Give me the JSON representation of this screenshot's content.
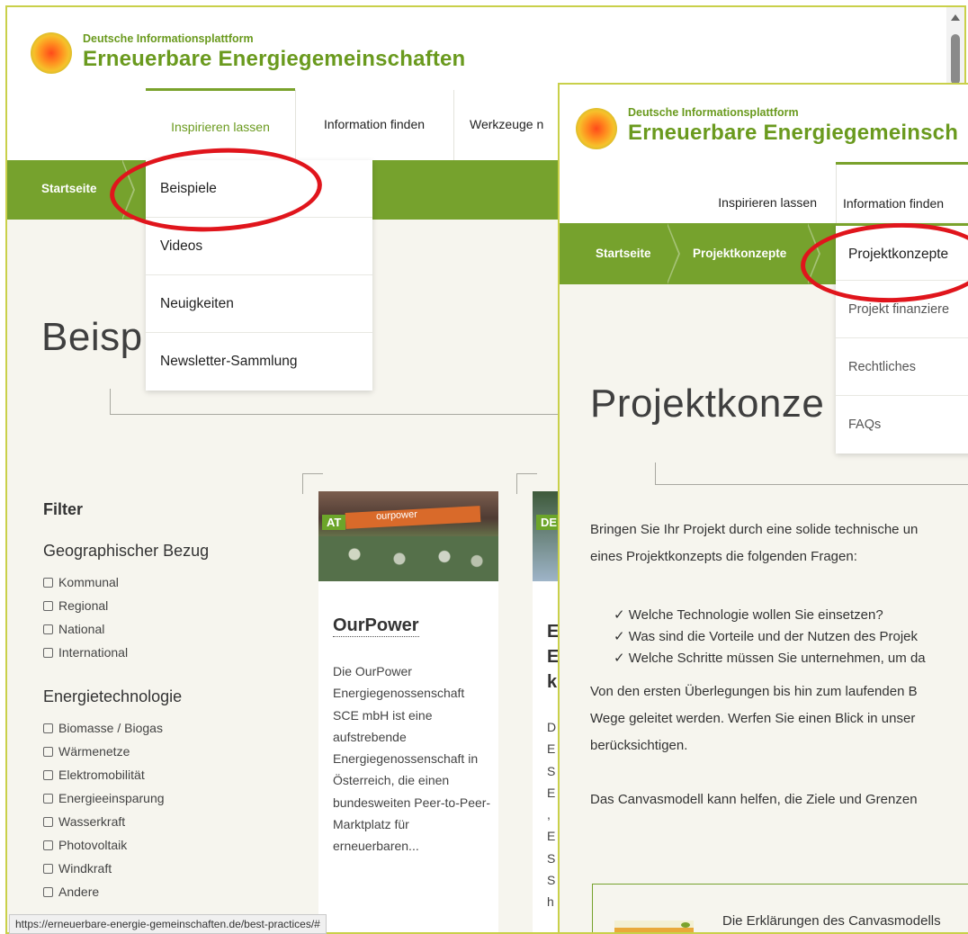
{
  "back": {
    "logo": {
      "sub": "Deutsche Informationsplattform",
      "main": "Erneuerbare Energiegemeinschaften"
    },
    "nav": [
      "Inspirieren lassen",
      "Information finden",
      "Werkzeuge n"
    ],
    "breadcrumb": [
      "Startseite"
    ],
    "dropdown": [
      "Beispiele",
      "Videos",
      "Neuigkeiten",
      "Newsletter-Sammlung"
    ],
    "page_title": "Beisp",
    "filter": {
      "heading": "Filter",
      "groups": [
        {
          "title": "Geographischer Bezug",
          "options": [
            "Kommunal",
            "Regional",
            "National",
            "International"
          ]
        },
        {
          "title": "Energietechnologie",
          "options": [
            "Biomasse / Biogas",
            "Wärmenetze",
            "Elektromobilität",
            "Energieeinsparung",
            "Wasserkraft",
            "Photovoltaik",
            "Windkraft",
            "Andere"
          ]
        }
      ]
    },
    "cards": [
      {
        "tag": "AT",
        "image_text": "ourpower",
        "title": "OurPower",
        "text": "Die OurPower Energiegenossenschaft SCE mbH ist eine aufstrebende Energiegenossenschaft in Österreich, die einen bundesweiten Peer-to-Peer-Marktplatz für erneuerbaren..."
      },
      {
        "tag": "DE",
        "title_letters": [
          "E",
          "E",
          "k"
        ],
        "text_letters": [
          "D",
          "E",
          "S",
          "E",
          ",",
          "E",
          "S",
          "S",
          "h"
        ]
      }
    ],
    "status_url": "https://erneuerbare-energie-gemeinschaften.de/best-practices/#"
  },
  "front": {
    "logo": {
      "sub": "Deutsche Informationsplattform",
      "main": "Erneuerbare Energiegemeinsch"
    },
    "nav": [
      "Inspirieren lassen",
      "Information finden"
    ],
    "breadcrumb": [
      "Startseite",
      "Projektkonzepte"
    ],
    "dropdown": [
      "Projektkonzepte",
      "Projekt finanziere",
      "Rechtliches",
      "FAQs"
    ],
    "page_title": "Projektkonze",
    "intro": [
      "Bringen Sie Ihr Projekt durch eine solide technische un",
      "eines Projektkonzepts die folgenden Fragen:"
    ],
    "checklist": [
      "✓ Welche Technologie wollen Sie einsetzen?",
      "✓ Was sind die Vorteile und der Nutzen des Projek",
      "✓ Welche Schritte müssen Sie unternehmen, um da"
    ],
    "para2": [
      "Von den ersten Überlegungen bis hin zum laufenden B",
      "Wege geleitet werden. Werfen Sie einen Blick in unser",
      "berücksichtigen."
    ],
    "para3": "Das Canvasmodell kann helfen, die Ziele und Grenzen",
    "box_text": "Die Erklärungen des Canvasmodells"
  },
  "colors": {
    "brand_green": "#76a22d",
    "annotation_red": "#e0151c"
  }
}
